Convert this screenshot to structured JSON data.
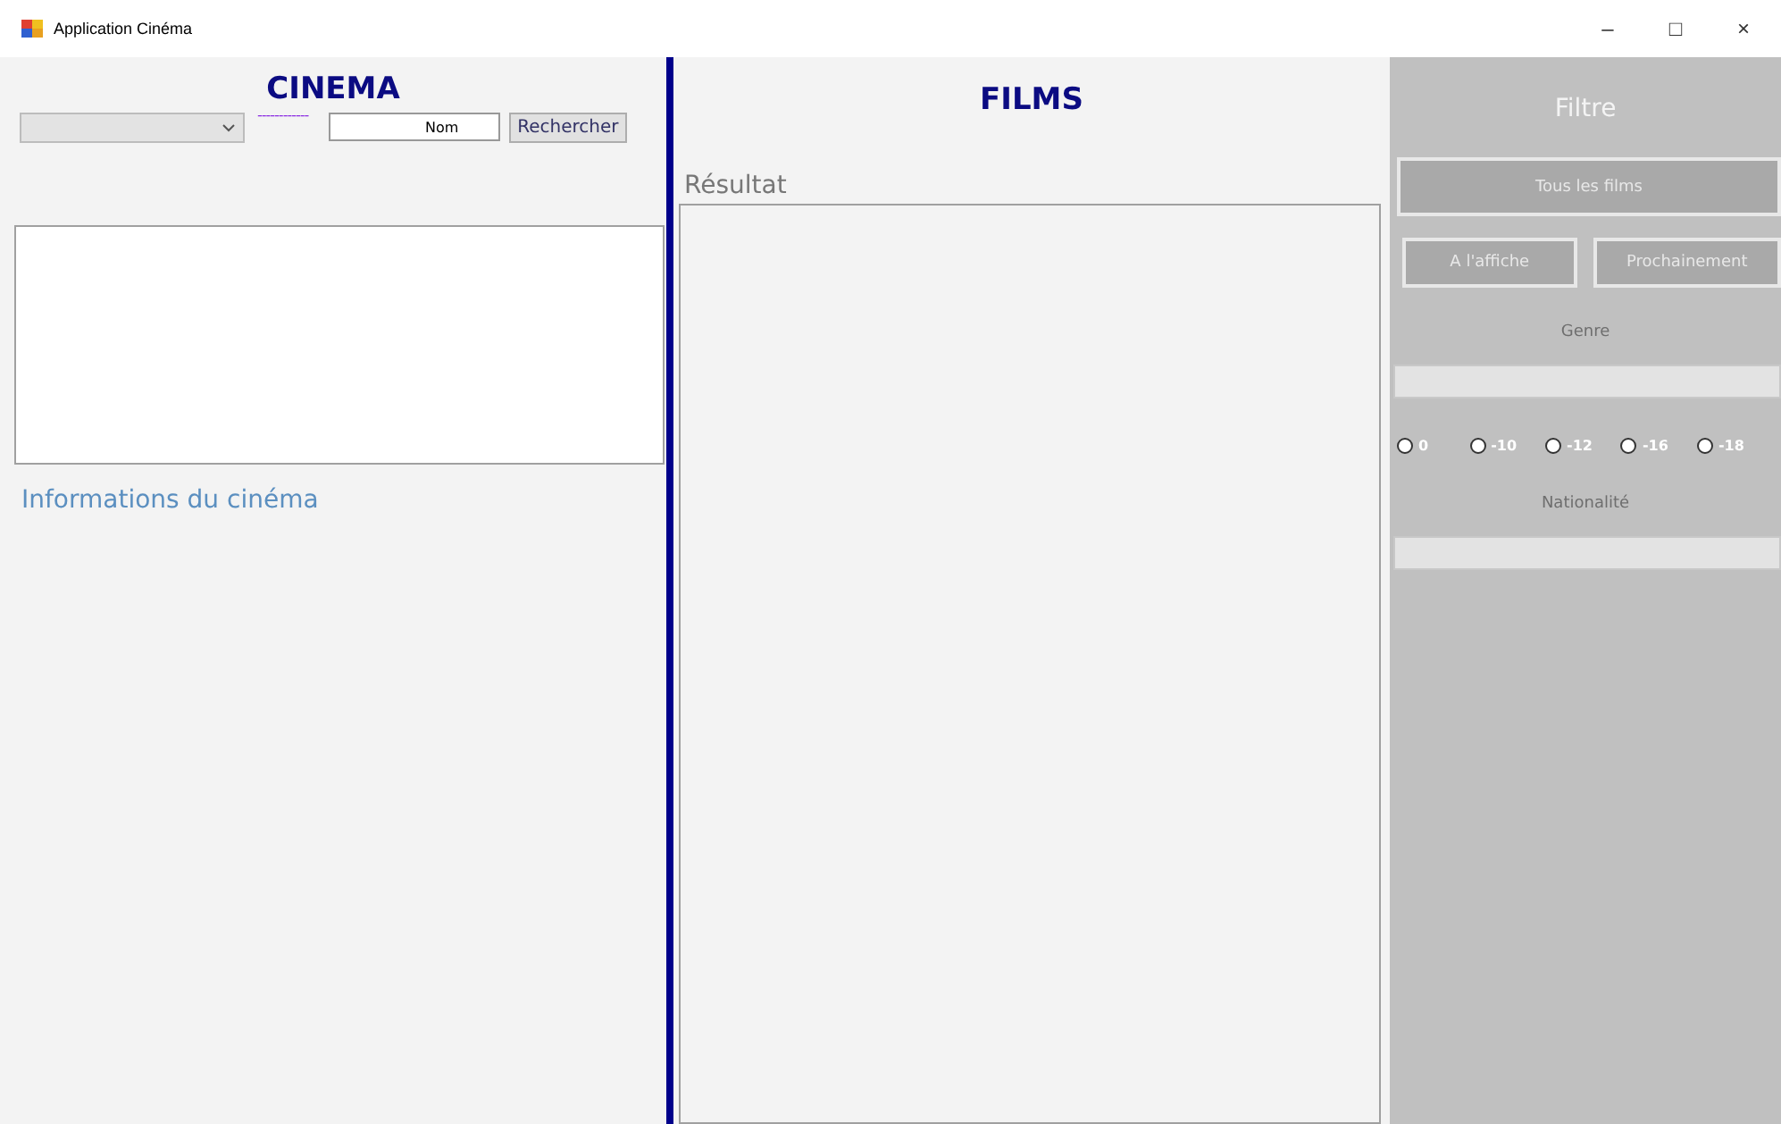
{
  "window": {
    "title": "Application Cinéma",
    "controls": [
      "–",
      "□",
      "×"
    ]
  },
  "cinema": {
    "title": "CINEMA",
    "separator": "------------",
    "search": {
      "value": "Nom"
    },
    "search_button": "Rechercher",
    "info_label": "Informations du cinéma"
  },
  "films": {
    "title": "FILMS",
    "result_label": "Résultat"
  },
  "filter": {
    "title": "Filtre",
    "all_button": "Tous les films",
    "buttons": [
      "A l'affiche",
      "Prochainement"
    ],
    "genre_label": "Genre",
    "ratings": [
      {
        "label": "0",
        "selected": false
      },
      {
        "label": "-10",
        "selected": false
      },
      {
        "label": "-12",
        "selected": false
      },
      {
        "label": "-16",
        "selected": false
      },
      {
        "label": "-18",
        "selected": false
      }
    ],
    "nationality_label": "Nationalité"
  }
}
